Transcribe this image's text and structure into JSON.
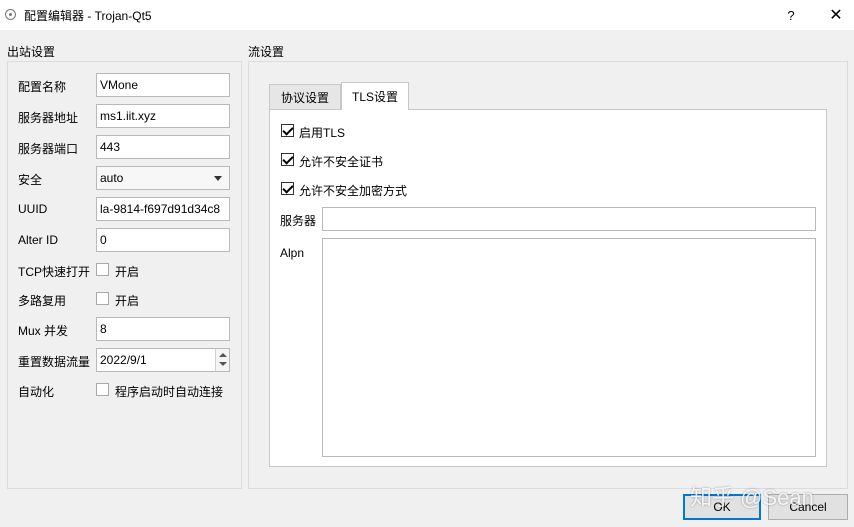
{
  "window": {
    "title": "配置编辑器 - Trojan-Qt5",
    "help_label": "?",
    "close_label": "✕"
  },
  "outbound": {
    "group_title": "出站设置",
    "rows": {
      "config_name": {
        "label": "配置名称",
        "value": "VMone"
      },
      "server_address": {
        "label": "服务器地址",
        "value": "ms1.iit.xyz"
      },
      "server_port": {
        "label": "服务器端口",
        "value": "443"
      },
      "security": {
        "label": "安全",
        "value": "auto"
      },
      "uuid": {
        "label": "UUID",
        "value": "la-9814-f697d91d34c8"
      },
      "alter_id": {
        "label": "Alter ID",
        "value": "0"
      },
      "tcp_fast_open": {
        "label": "TCP快速打开",
        "checkbox_label": "开启",
        "checked": false
      },
      "mux": {
        "label": "多路复用",
        "checkbox_label": "开启",
        "checked": false
      },
      "mux_concurrency": {
        "label": "Mux 并发",
        "value": "8"
      },
      "reset_traffic": {
        "label": "重置数据流量",
        "value": "2022/9/1"
      },
      "automation": {
        "label": "自动化",
        "checkbox_label": "程序启动时自动连接",
        "checked": false
      }
    }
  },
  "stream": {
    "group_title": "流设置",
    "tabs": [
      {
        "label": "协议设置",
        "active": false
      },
      {
        "label": "TLS设置",
        "active": true
      }
    ],
    "tls": {
      "enable_tls": {
        "label": "启用TLS",
        "checked": true
      },
      "allow_insecure_cert": {
        "label": "允许不安全证书",
        "checked": true
      },
      "allow_insecure_ciphers": {
        "label": "允许不安全加密方式",
        "checked": true
      },
      "server_label": "服务器",
      "server_value": "",
      "alpn_label": "Alpn",
      "alpn_value": ""
    }
  },
  "buttons": {
    "ok": "OK",
    "cancel": "Cancel"
  },
  "watermark": "知乎 @Sean",
  "colors": {
    "dialog_bg": "#f0f0f0",
    "default_button_border": "#0078d7"
  }
}
